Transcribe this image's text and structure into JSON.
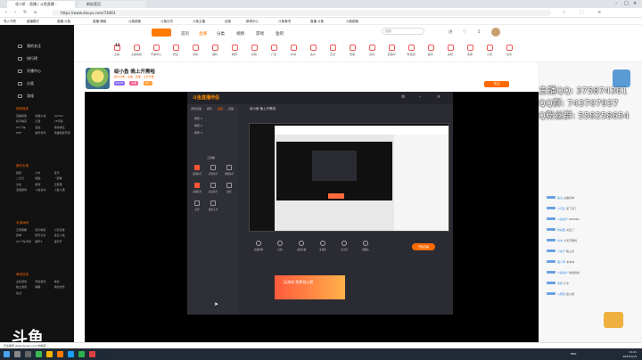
{
  "browser": {
    "tabs": [
      "花小虾 - 直播 | 斗鱼直播 -",
      "新标签页"
    ],
    "url": "https://www.douyu.com/74463",
    "bookmarks": [
      "导入书签",
      "直播模式",
      "直播·斗鱼",
      "直播·弹幕",
      "斗鱼超管",
      "斗鱼日历",
      "斗鱼主播",
      "百度",
      "新闻中心",
      "斗鱼鱼吧",
      "直播·斗鱼",
      "斗鱼超管"
    ]
  },
  "sidebar": {
    "nav": [
      "我的关注",
      "排行榜",
      "开播中心",
      "分类",
      "游戏"
    ],
    "sections": [
      {
        "title": "网游竞技",
        "items": [
          "英雄联盟",
          "穿越火线",
          "DOTA2",
          "和平精英",
          "王者",
          "CF手游",
          "QQ飞车",
          "逆战",
          "绝地求生",
          "DNF",
          "魔兽世界",
          "英雄联盟手游"
        ]
      },
      {
        "title": "娱乐天地",
        "items": [
          "颜值",
          "户外",
          "音乐",
          "二次元",
          "舞蹈",
          "一起看",
          "交友",
          "星秀",
          "正能量",
          "深夜剧场",
          "斗鱼读书",
          "小鱼小酒"
        ]
      },
      {
        "title": "手游休闲",
        "items": [
          "王者荣耀",
          "和平精英",
          "火影忍者",
          "原神",
          "明日方舟",
          "第五人格",
          "QQ飞车手游",
          "崩坏3",
          "金铲铲"
        ]
      },
      {
        "title": "单机热游",
        "items": [
          "主机游戏",
          "怀旧游戏",
          "单机",
          "独立游戏",
          "策略",
          "我的世界",
          "仙剑"
        ]
      }
    ],
    "logo": "斗鱼 房间号"
  },
  "header": {
    "nav": [
      "首页",
      "直播",
      "分类",
      "视频",
      "游戏",
      "鱼吧"
    ],
    "active_nav": "直播",
    "search_placeholder": "搜索"
  },
  "categories": [
    {
      "label": "主播",
      "badge": "12"
    },
    {
      "label": "主播等级"
    },
    {
      "label": "开播中心"
    },
    {
      "label": "粉丝"
    },
    {
      "label": "领取"
    },
    {
      "label": "福利"
    },
    {
      "label": "推荐"
    },
    {
      "label": "贵族"
    },
    {
      "label": "广告"
    },
    {
      "label": "商城"
    },
    {
      "label": "鱼丸"
    },
    {
      "label": "互动"
    },
    {
      "label": "赛事"
    },
    {
      "label": "活动"
    },
    {
      "label": "直播间"
    },
    {
      "label": "粉丝团"
    },
    {
      "label": "超管"
    },
    {
      "label": "鱼吧"
    },
    {
      "label": "客服"
    },
    {
      "label": "心愿"
    },
    {
      "label": "任务"
    }
  ],
  "streamer": {
    "title": "绽小鱼 晚上开黑啦",
    "tagline": "官方分类 · 主播 · 直播 · 今日开黑",
    "pills": [
      "LV.10",
      "主播",
      "热门"
    ],
    "follow": "关注"
  },
  "obs": {
    "logo": "斗鱼直播伴侣",
    "tabs": [
      "游戏直播",
      "娱乐",
      "美颜",
      "直播"
    ],
    "active_tab": "美颜",
    "stream_title": "绽小鱼 晚上开黑啦",
    "scenes": [
      "场景 1",
      "场景 2",
      "场景 3"
    ],
    "tools_header": "工具箱",
    "tools": [
      "直播助手",
      "房管助手",
      "弹幕助手",
      "主播任务",
      "语音助手",
      "抽奖",
      "录屏",
      "我的工具"
    ],
    "controls": [
      "直播弹幕",
      "音效",
      "虚拟直播",
      "多媒体",
      "麦克风",
      "摄像头"
    ],
    "live_button": "开始直播",
    "ad": "玩游戏 免费领火箭"
  },
  "overlay": [
    "主播QQ: 375874361",
    "QQ群: 743707937",
    "Q粉丝群: 558258654"
  ],
  "chat": {
    "lines": [
      {
        "user": "鱼丸",
        "text": "主播好帅"
      },
      {
        "user": "小可爱",
        "text": "来了来了"
      },
      {
        "user": "斗鱼用户",
        "text": "666666"
      },
      {
        "user": "粉丝团",
        "text": "关注了"
      },
      {
        "user": "水友",
        "text": "今天开黑吗"
      },
      {
        "user": "小鱼干",
        "text": "晚上好"
      },
      {
        "user": "路人甲",
        "text": "冲冲冲"
      },
      {
        "user": "斗鱼用户",
        "text": "哈哈哈哈"
      },
      {
        "user": "老粉",
        "text": "打卡"
      },
      {
        "user": "火箭哥",
        "text": "送火箭"
      }
    ]
  },
  "status_bar": "正在等待 www.douyu.com 的响应...",
  "taskbar": {
    "time": "21:21",
    "date": "2023/1/15",
    "lang": "ENG"
  }
}
